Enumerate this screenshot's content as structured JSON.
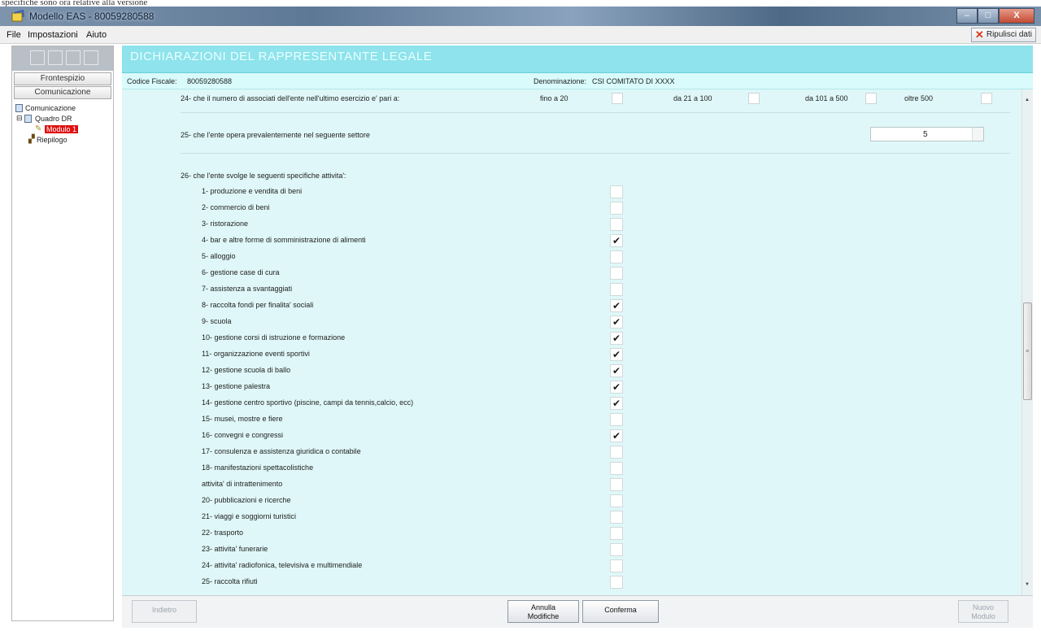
{
  "window": {
    "top_strip_text": "specifiche sono ora relative alla versione",
    "title": "Modello EAS - 80059280588",
    "buttons": {
      "minimize": "–",
      "maximize": "□",
      "close": "X"
    }
  },
  "menu": {
    "items": [
      "File",
      "Impostazioni",
      "Aiuto"
    ],
    "reset_label": "Ripulisci dati"
  },
  "left_panel": {
    "tabs": [
      "Frontespizio",
      "Comunicazione"
    ],
    "tree": [
      {
        "label": "Comunicazione",
        "level": 0
      },
      {
        "label": "Quadro DR",
        "level": 1
      },
      {
        "label": "Modulo 1",
        "level": 2,
        "selected": true
      },
      {
        "label": "Riepilogo",
        "level": 1
      }
    ]
  },
  "header": {
    "title": "DICHIARAZIONI DEL RAPPRESENTANTE LEGALE",
    "codice_fiscale_label": "Codice Fiscale:",
    "codice_fiscale": "80059280588",
    "denominazione_label": "Denominazione:",
    "denominazione": "CSI COMITATO DI XXXX"
  },
  "section24": {
    "text": "24- che il numero di associati dell'ente nell'ultimo esercizio e' pari a:",
    "options": [
      "fino a 20",
      "da 21 a 100",
      "da 101 a 500",
      "oltre 500"
    ]
  },
  "section25": {
    "text": "25- che l'ente opera prevalentemente nel seguente settore",
    "value": "5"
  },
  "section26": {
    "text": "26- che l'ente svolge le seguenti specifiche attivita':",
    "activities": [
      {
        "label": "1- produzione e vendita di beni",
        "checked": false
      },
      {
        "label": "2- commercio di beni",
        "checked": false
      },
      {
        "label": "3- ristorazione",
        "checked": false
      },
      {
        "label": "4- bar e altre forme di somministrazione di alimenti",
        "checked": true
      },
      {
        "label": "5- alloggio",
        "checked": false
      },
      {
        "label": "6- gestione case di cura",
        "checked": false
      },
      {
        "label": "7- assistenza a svantaggiati",
        "checked": false
      },
      {
        "label": "8- raccolta fondi per finalita' sociali",
        "checked": true
      },
      {
        "label": "9- scuola",
        "checked": true
      },
      {
        "label": "10- gestione corsi di istruzione e formazione",
        "checked": true
      },
      {
        "label": "11- organizzazione eventi sportivi",
        "checked": true
      },
      {
        "label": "12- gestione scuola di ballo",
        "checked": true
      },
      {
        "label": "13- gestione palestra",
        "checked": true
      },
      {
        "label": "14- gestione centro sportivo (piscine, campi da tennis,calcio, ecc)",
        "checked": true
      },
      {
        "label": "15- musei, mostre e fiere",
        "checked": false
      },
      {
        "label": "16- convegni e congressi",
        "checked": true
      },
      {
        "label": "17- consulenza e assistenza giuridica o contabile",
        "checked": false
      },
      {
        "label": "18- manifestazioni spettacolistiche",
        "checked": false
      },
      {
        "label": "attivita' di intrattenimento",
        "checked": false
      },
      {
        "label": "20- pubblicazioni e ricerche",
        "checked": false
      },
      {
        "label": "21- viaggi e soggiorni turistici",
        "checked": false
      },
      {
        "label": "22- trasporto",
        "checked": false
      },
      {
        "label": "23- attivita' funerarie",
        "checked": false
      },
      {
        "label": "24- attivita' radiofonica, televisiva e multimendiale",
        "checked": false
      },
      {
        "label": "25- raccolta rifiuti",
        "checked": false
      }
    ]
  },
  "bottom": {
    "back": "Indietro",
    "cancel_line1": "Annulla",
    "cancel_line2": "Modifiche",
    "confirm": "Conferma",
    "new_line1": "Nuovo",
    "new_line2": "Modulo"
  },
  "colors": {
    "header_band": "#8ee3ec",
    "content_bg": "#dff7f8",
    "selected_node": "#e01010"
  }
}
